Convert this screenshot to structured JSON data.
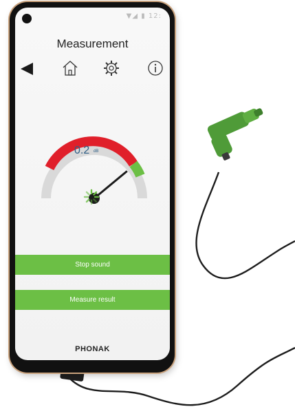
{
  "app": {
    "title": "Measurement",
    "brand": "PHONAK"
  },
  "status_bar": {
    "icons": "▼◢ ▮ 12:"
  },
  "nav": {
    "back_icon": "back-arrow-icon",
    "home_icon": "home-icon",
    "settings_icon": "gear-icon",
    "info_icon": "info-icon"
  },
  "gauge": {
    "value": "0.2",
    "unit": "dB",
    "level_fraction": 0.78,
    "colors": {
      "track": "#d9d9d9",
      "red": "#e01f2a",
      "green": "#6cbf45",
      "needle": "#1b1b1b",
      "value_text": "#2f5e86"
    }
  },
  "buttons": {
    "stop_sound": "Stop sound",
    "measure_result": "Measure result"
  },
  "colors": {
    "accent": "#6cbf45"
  }
}
